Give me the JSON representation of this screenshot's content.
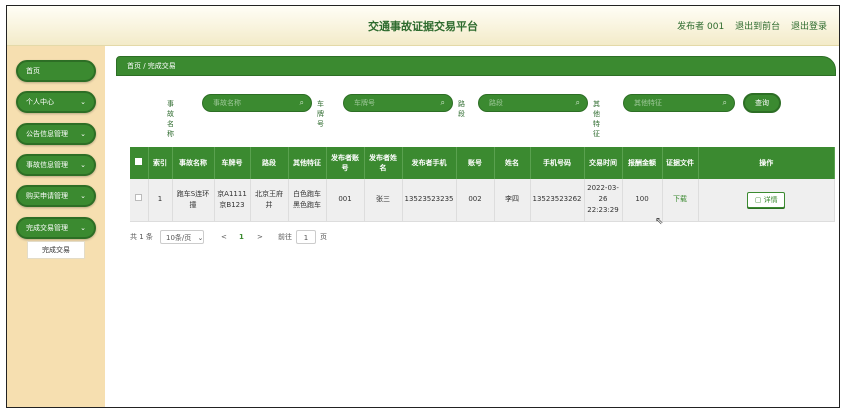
{
  "header": {
    "title": "交通事故证据交易平台",
    "user": "发布者 001",
    "front_link": "退出到前台",
    "logout_link": "退出登录"
  },
  "sidebar": {
    "items": [
      {
        "label": "首页",
        "chevron": false
      },
      {
        "label": "个人中心",
        "chevron": true
      },
      {
        "label": "公告信息管理",
        "chevron": true
      },
      {
        "label": "事故信息管理",
        "chevron": true
      },
      {
        "label": "购买申请管理",
        "chevron": true
      },
      {
        "label": "完成交易管理",
        "chevron": true
      }
    ],
    "sub_item": "完成交易"
  },
  "breadcrumb": "首页 / 完成交易",
  "search": {
    "fields": [
      {
        "label": "事故名称",
        "placeholder": "事故名称"
      },
      {
        "label": "车牌号",
        "placeholder": "车牌号"
      },
      {
        "label": "路段",
        "placeholder": "路段"
      },
      {
        "label": "其他特征",
        "placeholder": "其他特征"
      }
    ],
    "button": "查询"
  },
  "table": {
    "headers": [
      "",
      "索引",
      "事故名称",
      "车牌号",
      "路段",
      "其他特征",
      "发布者账号",
      "发布者姓名",
      "发布者手机",
      "账号",
      "姓名",
      "手机号码",
      "交易时间",
      "报酬金额",
      "证据文件",
      "操作"
    ],
    "rows": [
      {
        "index": "1",
        "name": "跑车S连环撞",
        "plate": "京A1111京B123",
        "road": "北京王府井",
        "feature": "白色跑车黑色跑车",
        "pub_account": "001",
        "pub_name": "张三",
        "pub_phone": "13523523235",
        "account": "002",
        "user_name": "李四",
        "phone": "13523523262",
        "time": "2022-03-26 22:23:29",
        "amount": "100",
        "file": "下载",
        "action": "详情"
      }
    ]
  },
  "pager": {
    "total": "共 1 条",
    "page_size": "10条/页",
    "prev": "<",
    "current": "1",
    "next": ">",
    "goto_label": "前往",
    "goto_value": "1",
    "goto_unit": "页"
  },
  "colors": {
    "accent": "#3b8a30",
    "sidebar_bg": "#f6dfb0"
  }
}
